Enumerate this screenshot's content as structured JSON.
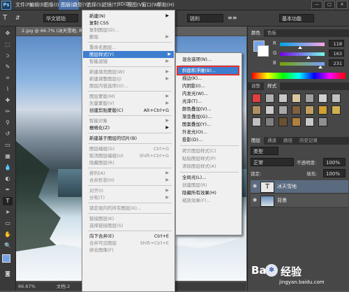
{
  "app": {
    "logo": "Ps"
  },
  "menubar": {
    "items": [
      "文件(F)",
      "编辑(E)",
      "图像(I)",
      "图层(L)",
      "类型(Y)",
      "选择(S)",
      "滤镜(T)",
      "3D(D)",
      "视图(V)",
      "窗口(W)",
      "帮助(H)"
    ],
    "active_index": 3,
    "window_buttons": [
      "—",
      "□",
      "✕"
    ]
  },
  "options": {
    "font_family": "华文琥珀",
    "antialias": "锐利",
    "workspace": "基本功能"
  },
  "document": {
    "tab_title": "2.jpg @ 66.7% (冰天雪地, RGB/8#) *",
    "zoom": "66.67%",
    "doc_info": "文档:2"
  },
  "layer_menu": {
    "items": [
      {
        "label": "新建(N)",
        "disabled": false,
        "arrow": true
      },
      {
        "label": "复制 CSS",
        "disabled": false
      },
      {
        "label": "复制图层(D)...",
        "disabled": true
      },
      {
        "label": "删除",
        "disabled": true,
        "arrow": true
      },
      {
        "sep": true
      },
      {
        "label": "重命名图层...",
        "disabled": true
      },
      {
        "label": "图层样式(Y)",
        "disabled": false,
        "arrow": true,
        "highlight": true
      },
      {
        "label": "智能滤镜",
        "disabled": true,
        "arrow": true
      },
      {
        "sep": true
      },
      {
        "label": "新建填充图层(W)",
        "disabled": true,
        "arrow": true
      },
      {
        "label": "新建调整图层(J)",
        "disabled": true,
        "arrow": true
      },
      {
        "label": "图层内容选项(O)...",
        "disabled": true
      },
      {
        "sep": true
      },
      {
        "label": "图层蒙版(M)",
        "disabled": true,
        "arrow": true
      },
      {
        "label": "矢量蒙版(V)",
        "disabled": true,
        "arrow": true
      },
      {
        "label": "创建剪贴蒙版(C)",
        "shortcut": "Alt+Ctrl+G",
        "disabled": false
      },
      {
        "sep": true
      },
      {
        "label": "智能对象",
        "disabled": true,
        "arrow": true
      },
      {
        "label": "栅格化(Z)",
        "disabled": false,
        "arrow": true
      },
      {
        "sep": true
      },
      {
        "label": "新建基于图层的切片(B)",
        "disabled": false
      },
      {
        "sep": true
      },
      {
        "label": "图层编组(G)",
        "shortcut": "Ctrl+G",
        "disabled": true
      },
      {
        "label": "取消图层编组(U)",
        "shortcut": "Shift+Ctrl+G",
        "disabled": true
      },
      {
        "label": "隐藏图层(R)",
        "disabled": true
      },
      {
        "sep": true
      },
      {
        "label": "排列(A)",
        "disabled": true,
        "arrow": true
      },
      {
        "label": "合并形状(H)",
        "disabled": true,
        "arrow": true
      },
      {
        "sep": true
      },
      {
        "label": "对齐(I)",
        "disabled": true,
        "arrow": true
      },
      {
        "label": "分布(T)",
        "disabled": true,
        "arrow": true
      },
      {
        "sep": true
      },
      {
        "label": "锁定组内的所有图层(X)...",
        "disabled": true
      },
      {
        "sep": true
      },
      {
        "label": "链接图层(K)",
        "disabled": true
      },
      {
        "label": "选择链接图层(S)",
        "disabled": true
      },
      {
        "sep": true
      },
      {
        "label": "向下合并(E)",
        "shortcut": "Ctrl+E",
        "disabled": false
      },
      {
        "label": "合并可见图层",
        "shortcut": "Shift+Ctrl+E",
        "disabled": true
      },
      {
        "label": "拼合图像(F)",
        "disabled": true
      }
    ]
  },
  "style_submenu": {
    "items": [
      {
        "label": "混合选项(N)...",
        "disabled": false
      },
      {
        "sep": true
      },
      {
        "label": "斜面和浮雕(B)...",
        "disabled": false,
        "highlight": true
      },
      {
        "label": "描边(K)...",
        "disabled": false
      },
      {
        "label": "内阴影(I)...",
        "disabled": false
      },
      {
        "label": "内发光(W)...",
        "disabled": false
      },
      {
        "label": "光泽(T)...",
        "disabled": false
      },
      {
        "label": "颜色叠加(V)...",
        "disabled": false
      },
      {
        "label": "渐变叠加(G)...",
        "disabled": false
      },
      {
        "label": "图案叠加(Y)...",
        "disabled": false
      },
      {
        "label": "外发光(O)...",
        "disabled": false
      },
      {
        "label": "投影(D)...",
        "disabled": false
      },
      {
        "sep": true
      },
      {
        "label": "拷贝图层样式(C)",
        "disabled": true
      },
      {
        "label": "粘贴图层样式(P)",
        "disabled": true
      },
      {
        "label": "清除图层样式(A)",
        "disabled": true
      },
      {
        "sep": true
      },
      {
        "label": "全局光(L)...",
        "disabled": false
      },
      {
        "label": "创建图层(R)",
        "disabled": true
      },
      {
        "label": "隐藏所有效果(H)",
        "disabled": false
      },
      {
        "label": "缩放效果(F)...",
        "disabled": true
      }
    ]
  },
  "color_panel": {
    "tabs": [
      "颜色",
      "色板"
    ],
    "channels": [
      {
        "label": "R",
        "value": "118",
        "level": 0.46
      },
      {
        "label": "G",
        "value": "163",
        "level": 0.64
      },
      {
        "label": "B",
        "value": "231",
        "level": 0.91
      }
    ],
    "fg_color": "#76a3e7",
    "bg_color": "#ffffff"
  },
  "styles_panel": {
    "tabs": [
      "调整",
      "样式"
    ],
    "swatch_colors": [
      "#e04040",
      "#b0b0b0",
      "#c8c8c8",
      "#d8c8a0",
      "#a0a0a0",
      "#d0d0d0",
      "#c0c0c0",
      "#b09060",
      "#cccccc",
      "#a8a8a8",
      "#806040",
      "#c0a060",
      "#d0a030",
      "#d0b050",
      "#c0c0c0",
      "#808080",
      "#6a5030",
      "#b08040",
      "#c8c8c8",
      "#909090"
    ]
  },
  "layers_panel": {
    "tabs": [
      "图层",
      "通道",
      "路径",
      "历史记录"
    ],
    "kind_label": "类型",
    "blend_mode": "正常",
    "opacity_label": "不透明度:",
    "opacity": "100%",
    "lock_label": "锁定:",
    "fill_label": "填充:",
    "fill": "100%",
    "layers": [
      {
        "name": "冰天雪地",
        "type": "text",
        "selected": true
      },
      {
        "name": "背景",
        "type": "image",
        "selected": false
      }
    ]
  },
  "watermark": {
    "brand": "Bai",
    "brand2": "经验",
    "url": "jingyan.baidu.com"
  }
}
